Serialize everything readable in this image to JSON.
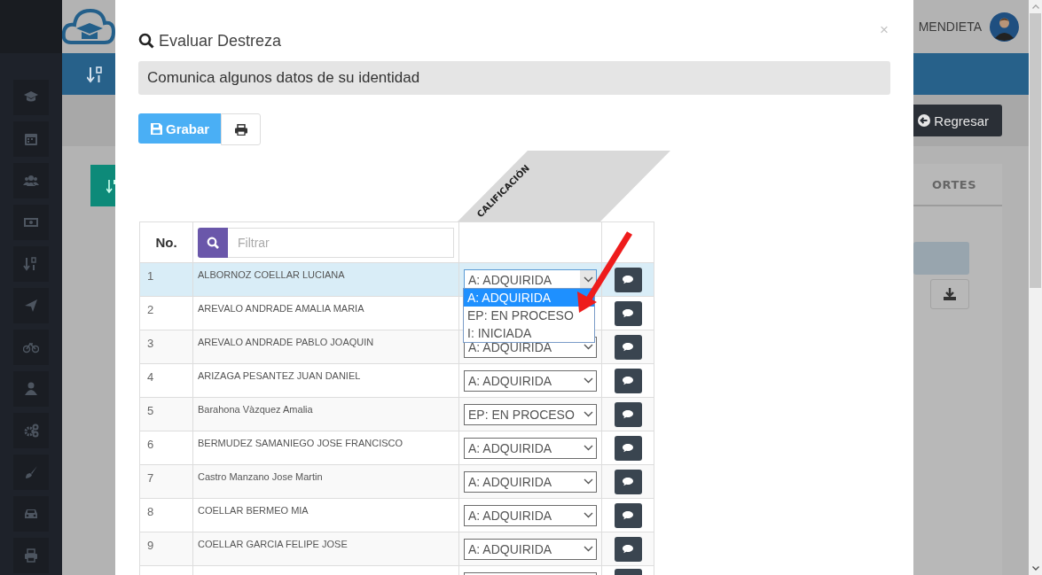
{
  "header": {
    "user_name": "MENDIETA"
  },
  "toolbar": {
    "back_button": "Regresar"
  },
  "panel": {
    "tab_fragment": "ORTES"
  },
  "modal": {
    "title": "Evaluar Destreza",
    "close": "×",
    "skill": "Comunica algunos datos de su identidad",
    "save_button": "Grabar",
    "grade_header": "CALIFICACIÓN",
    "number_header": "No.",
    "filter_placeholder": "Filtrar",
    "rows": [
      {
        "number": "1",
        "name": "ALBORNOZ COELLAR LUCIANA",
        "grade": "A: ADQUIRIDA",
        "selected": true,
        "options": [
          {
            "label": "A: ADQUIRIDA",
            "selected": true
          },
          {
            "label": "EP: EN PROCESO",
            "selected": false
          },
          {
            "label": "I: INICIADA",
            "selected": false
          }
        ]
      },
      {
        "number": "2",
        "name": "AREVALO ANDRADE AMALIA MARIA",
        "selected": false
      },
      {
        "number": "3",
        "name": "AREVALO ANDRADE PABLO JOAQUIN",
        "grade": "A: ADQUIRIDA",
        "selected": false
      },
      {
        "number": "4",
        "name": "ARIZAGA PESANTEZ JUAN DANIEL",
        "grade": "A: ADQUIRIDA",
        "selected": false
      },
      {
        "number": "5",
        "name": "Barahona Vàzquez Amalia",
        "grade": "EP: EN PROCESO",
        "selected": false
      },
      {
        "number": "6",
        "name": "BERMUDEZ SAMANIEGO JOSE FRANCISCO",
        "grade": "A: ADQUIRIDA",
        "selected": false
      },
      {
        "number": "7",
        "name": "Castro Manzano Jose Martin",
        "grade": "A: ADQUIRIDA",
        "selected": false
      },
      {
        "number": "8",
        "name": "COELLAR BERMEO MIA",
        "grade": "A: ADQUIRIDA",
        "selected": false
      },
      {
        "number": "9",
        "name": "COELLAR GARCIA FELIPE JOSE",
        "grade": "A: ADQUIRIDA",
        "selected": false
      }
    ]
  }
}
